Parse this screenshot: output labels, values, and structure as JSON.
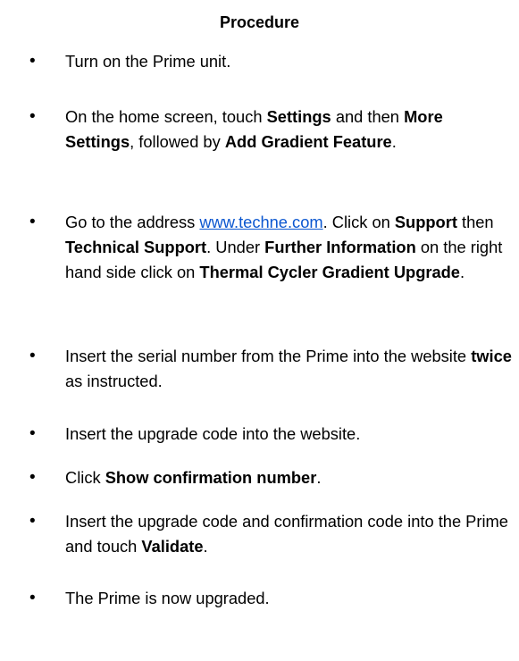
{
  "title": "Procedure",
  "steps": [
    {
      "parts": [
        {
          "t": "Turn on the Prime unit."
        }
      ]
    },
    {
      "parts": [
        {
          "t": "On the home screen, touch "
        },
        {
          "t": "Settings",
          "b": true
        },
        {
          "t": " and then "
        },
        {
          "t": "More Settings",
          "b": true
        },
        {
          "t": ", followed by "
        },
        {
          "t": "Add Gradient Feature",
          "b": true
        },
        {
          "t": "."
        }
      ]
    },
    {
      "parts": [
        {
          "t": "Go to the address "
        },
        {
          "t": "www.techne.com",
          "link": true
        },
        {
          "t": ". Click on "
        },
        {
          "t": "Support",
          "b": true
        },
        {
          "t": " then "
        },
        {
          "t": "Technical Support",
          "b": true
        },
        {
          "t": ". Under "
        },
        {
          "t": "Further Information",
          "b": true
        },
        {
          "t": " on the right hand side click on "
        },
        {
          "t": "Thermal Cycler Gradient Upgrade",
          "b": true
        },
        {
          "t": "."
        }
      ]
    },
    {
      "parts": [
        {
          "t": "Insert the serial number from the Prime into the website "
        },
        {
          "t": "twice",
          "b": true
        },
        {
          "t": " as instructed."
        }
      ]
    },
    {
      "parts": [
        {
          "t": "Insert the upgrade code into the website."
        }
      ]
    },
    {
      "parts": [
        {
          "t": "Click "
        },
        {
          "t": "Show confirmation number",
          "b": true
        },
        {
          "t": "."
        }
      ]
    },
    {
      "parts": [
        {
          "t": "Insert the upgrade code and confirmation code into the Prime and touch "
        },
        {
          "t": "Validate",
          "b": true
        },
        {
          "t": "."
        }
      ]
    },
    {
      "parts": [
        {
          "t": "The Prime is now upgraded."
        }
      ]
    }
  ],
  "bullet_glyph": "•",
  "colors": {
    "text": "#000000",
    "link": "#0b57d0",
    "background": "#ffffff"
  }
}
